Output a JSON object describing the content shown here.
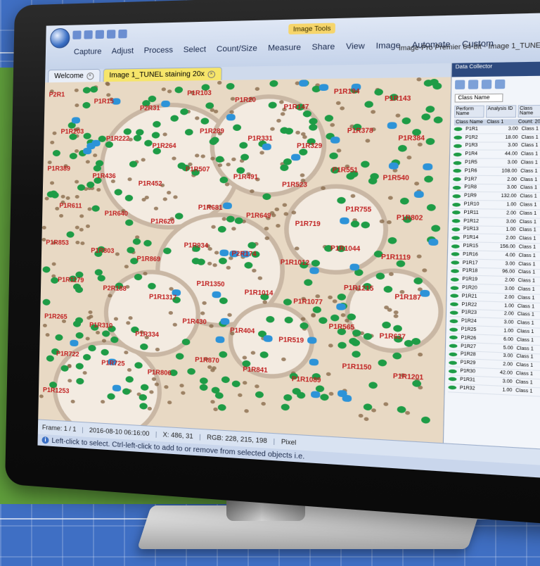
{
  "menu": [
    "Capture",
    "Adjust",
    "Process",
    "Select",
    "Count/Size",
    "Measure",
    "Share",
    "View",
    "Image",
    "Automate",
    "Custom"
  ],
  "context_tab": "Image Tools",
  "window_title": "Image-Pro Premier 64-bit - Image 1_TUNEL staining 20x",
  "doc_tabs": [
    {
      "label": "Welcome",
      "active": false
    },
    {
      "label": "Image 1_TUNEL staining 20x",
      "active": true
    }
  ],
  "labels": [
    {
      "t": "P2R1"
    },
    {
      "t": "P1R15"
    },
    {
      "t": "P2R31"
    },
    {
      "t": "P1R103"
    },
    {
      "t": "P1R20"
    },
    {
      "t": "P1R147"
    },
    {
      "t": "P1R194"
    },
    {
      "t": "P1R143"
    },
    {
      "t": "P1R203"
    },
    {
      "t": "P1R222"
    },
    {
      "t": "P1R264"
    },
    {
      "t": "P1R289"
    },
    {
      "t": "P1R331"
    },
    {
      "t": "P1R329"
    },
    {
      "t": "P1R378"
    },
    {
      "t": "P1R384"
    },
    {
      "t": "P1R389"
    },
    {
      "t": "P1R436"
    },
    {
      "t": "P1R452"
    },
    {
      "t": "P1R507"
    },
    {
      "t": "P1R491"
    },
    {
      "t": "P1R523"
    },
    {
      "t": "P1R551"
    },
    {
      "t": "P1R540"
    },
    {
      "t": "P1R611"
    },
    {
      "t": "P1R640"
    },
    {
      "t": "P1R620"
    },
    {
      "t": "P1R681"
    },
    {
      "t": "P1R649"
    },
    {
      "t": "P1R719"
    },
    {
      "t": "P1R755"
    },
    {
      "t": "P1R802"
    },
    {
      "t": "P1R853"
    },
    {
      "t": "P1R803"
    },
    {
      "t": "P1R869"
    },
    {
      "t": "P1R934"
    },
    {
      "t": "P2R174"
    },
    {
      "t": "P1R1012"
    },
    {
      "t": "P1R1044"
    },
    {
      "t": "P1R1119"
    },
    {
      "t": "P1R1179"
    },
    {
      "t": "P2R188"
    },
    {
      "t": "P1R1317"
    },
    {
      "t": "P1R1350"
    },
    {
      "t": "P1R1014"
    },
    {
      "t": "P1R1077"
    },
    {
      "t": "P1R1215"
    },
    {
      "t": "P1R187"
    },
    {
      "t": "P1R265"
    },
    {
      "t": "P1R310"
    },
    {
      "t": "P1R334"
    },
    {
      "t": "P1R430"
    },
    {
      "t": "P1R404"
    },
    {
      "t": "P1R519"
    },
    {
      "t": "P1R565"
    },
    {
      "t": "P1R637"
    },
    {
      "t": "P1R722"
    },
    {
      "t": "P1R725"
    },
    {
      "t": "P1R806"
    },
    {
      "t": "P1R870"
    },
    {
      "t": "P1R841"
    },
    {
      "t": "P1R1089"
    },
    {
      "t": "P1R1150"
    },
    {
      "t": "P1R1201"
    },
    {
      "t": "P1R1253"
    }
  ],
  "panel": {
    "header": "Data Collector",
    "filter": "Class Name",
    "cols": [
      "Perform Name",
      "Analysis ID",
      "Class Name"
    ],
    "grid_head": [
      "Class Name",
      "Class 1",
      "Count: 2052"
    ],
    "rows": [
      {
        "name": "P1R1",
        "v": "3.00",
        "c": "Class 1"
      },
      {
        "name": "P1R2",
        "v": "18.00",
        "c": "Class 1"
      },
      {
        "name": "P1R3",
        "v": "3.00",
        "c": "Class 1"
      },
      {
        "name": "P1R4",
        "v": "44.00",
        "c": "Class 1"
      },
      {
        "name": "P1R5",
        "v": "3.00",
        "c": "Class 1"
      },
      {
        "name": "P1R6",
        "v": "108.00",
        "c": "Class 1"
      },
      {
        "name": "P1R7",
        "v": "2.00",
        "c": "Class 1"
      },
      {
        "name": "P1R8",
        "v": "3.00",
        "c": "Class 1"
      },
      {
        "name": "P1R9",
        "v": "132.00",
        "c": "Class 1"
      },
      {
        "name": "P1R10",
        "v": "1.00",
        "c": "Class 1"
      },
      {
        "name": "P1R11",
        "v": "2.00",
        "c": "Class 1"
      },
      {
        "name": "P1R12",
        "v": "3.00",
        "c": "Class 1"
      },
      {
        "name": "P1R13",
        "v": "1.00",
        "c": "Class 1"
      },
      {
        "name": "P1R14",
        "v": "2.00",
        "c": "Class 1"
      },
      {
        "name": "P1R15",
        "v": "156.00",
        "c": "Class 1"
      },
      {
        "name": "P1R16",
        "v": "4.00",
        "c": "Class 1"
      },
      {
        "name": "P1R17",
        "v": "3.00",
        "c": "Class 1"
      },
      {
        "name": "P1R18",
        "v": "96.00",
        "c": "Class 1"
      },
      {
        "name": "P1R19",
        "v": "2.00",
        "c": "Class 1"
      },
      {
        "name": "P1R20",
        "v": "3.00",
        "c": "Class 1"
      },
      {
        "name": "P1R21",
        "v": "2.00",
        "c": "Class 1"
      },
      {
        "name": "P1R22",
        "v": "1.00",
        "c": "Class 1"
      },
      {
        "name": "P1R23",
        "v": "2.00",
        "c": "Class 1"
      },
      {
        "name": "P1R24",
        "v": "3.00",
        "c": "Class 1"
      },
      {
        "name": "P1R25",
        "v": "1.00",
        "c": "Class 1"
      },
      {
        "name": "P1R26",
        "v": "6.00",
        "c": "Class 1"
      },
      {
        "name": "P1R27",
        "v": "5.00",
        "c": "Class 1"
      },
      {
        "name": "P1R28",
        "v": "3.00",
        "c": "Class 1"
      },
      {
        "name": "P1R29",
        "v": "2.00",
        "c": "Class 1"
      },
      {
        "name": "P1R30",
        "v": "42.00",
        "c": "Class 1"
      },
      {
        "name": "P1R31",
        "v": "3.00",
        "c": "Class 1"
      },
      {
        "name": "P1R32",
        "v": "1.00",
        "c": "Class 1"
      }
    ]
  },
  "status": {
    "frame": "Frame: 1 / 1",
    "date": "2016-08-10 06:16:00",
    "coords": "X: 486, 31",
    "rgb": "RGB: 228, 215, 198",
    "mode": "Pixel"
  },
  "hint": "Left-click to select. Ctrl-left-click to add to or remove from selected objects i.e.",
  "colors": {
    "accent": "#3a6fc4",
    "positive": "#1e9c46",
    "tunel_blue": "#2d93d8",
    "label_red": "#c02020"
  }
}
